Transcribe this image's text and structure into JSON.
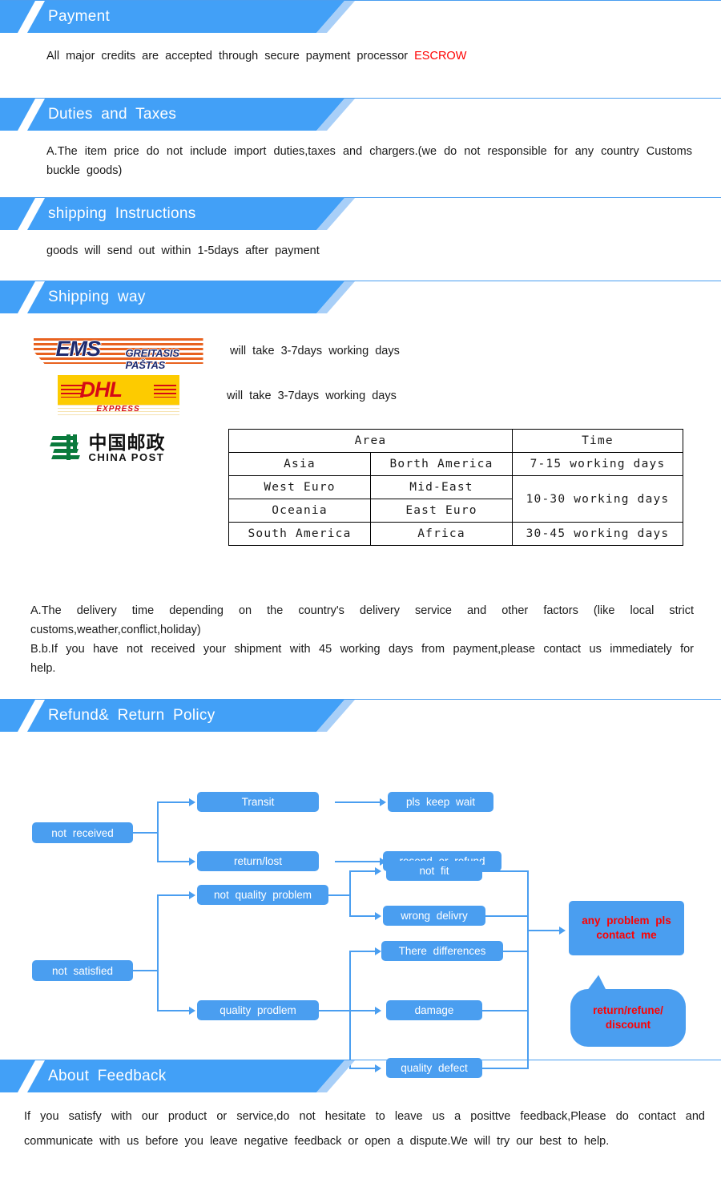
{
  "theme": {
    "banner_blue": "#42a0f7",
    "accent_blue": "#4a9ef0",
    "alert_red": "#ff0000"
  },
  "sections": {
    "payment": {
      "title": "Payment",
      "text_before": "All  major  credits  are  accepted  through  secure  payment  processor",
      "highlight": "ESCROW"
    },
    "duties": {
      "title": "Duties  and  Taxes",
      "text": "A.The  item  price  do  not  include  import  duties,taxes  and  chargers.(we  do  not  responsible  for  any  country  Customs  buckle  goods)"
    },
    "shipping_instructions": {
      "title": "shipping  Instructions",
      "text": "goods  will  send  out  within  1-5days  after  payment"
    },
    "shipping_way": {
      "title": "Shipping  way",
      "carriers": [
        {
          "logo": "ems-logo",
          "name": "EMS",
          "subtitle": "GREITASIS PAŠTAS",
          "note": "will  take  3-7days  working  days"
        },
        {
          "logo": "dhl-logo",
          "name": "DHL",
          "subtitle": "EXPRESS",
          "note": "will  take  3-7days  working  days"
        },
        {
          "logo": "china-post-logo",
          "name": "中国邮政",
          "subtitle": "CHINA POST",
          "note": ""
        }
      ],
      "table": {
        "headers": [
          "Area",
          "Time"
        ],
        "rows": [
          {
            "area1": "Asia",
            "area2": "Borth America",
            "time": "7-15 working days"
          },
          {
            "area1": "West Euro",
            "area2": "Mid-East",
            "time": "10-30 working days"
          },
          {
            "area1": "Oceania",
            "area2": "East Euro",
            "time": ""
          },
          {
            "area1": "South America",
            "area2": "Africa",
            "time": "30-45 working days"
          }
        ]
      },
      "notes": [
        "A.The  delivery  time  depending  on  the  country's  delivery  service  and  other  factors  (like  local  strict  customs,weather,conflict,holiday)",
        "B.b.If  you  have  not  received  your  shipment  with  45  working  days  from  payment,please  contact  us  immediately  for  help."
      ]
    },
    "refund": {
      "title": "Refund&  Return  Policy",
      "flow": {
        "not_received": "not  received",
        "transit": "Transit",
        "return_lost": "return/lost",
        "pls_keep_wait": "pls  keep  wait",
        "resend_or_refund": "resend  or  refund",
        "not_satisfied": "not  satisfied",
        "not_quality_problem": "not  quality  problem",
        "quality_prodlem": "quality  prodlem",
        "not_fit": "not  fit",
        "wrong_delivry": "wrong  delivry",
        "there_differences": "There  differences",
        "damage": "damage",
        "quality_defect": "quality  defect",
        "contact_me_line1": "any  problem  pls",
        "contact_me_line2": "contact  me",
        "outcome_line1": "return/refune/",
        "outcome_line2": "discount"
      }
    },
    "feedback": {
      "title": "About  Feedback",
      "text": "If  you  satisfy  with  our  product  or  service,do  not  hesitate  to  leave  us  a  posittve  feedback,Please  do  contact  and  communicate  with  us  before  you  leave  negative  feedback  or  open  a  dispute.We  will  try  our  best  to  help."
    }
  }
}
